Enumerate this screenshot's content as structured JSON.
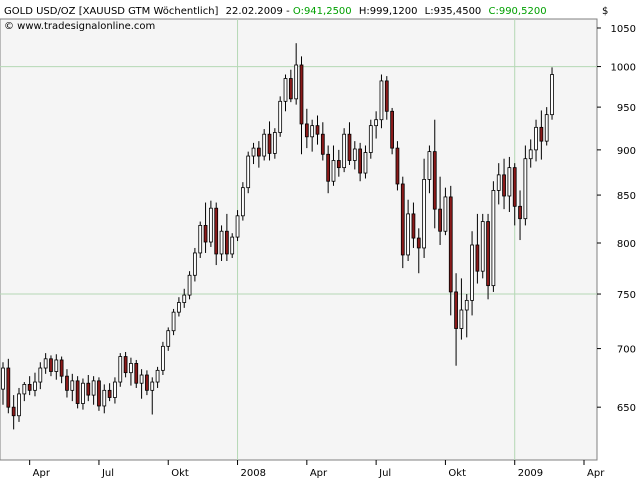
{
  "header": {
    "symbol": "GOLD USD/OZ [XAUUSD GTM  Wöchentlich]",
    "date": "22.02.2009",
    "sep": " - ",
    "open": "O:941,2500",
    "high": "H:999,1200",
    "low": "L:935,4500",
    "close": "C:990,5200",
    "source": "© www.tradesignalonline.com"
  },
  "axis_unit": "$",
  "colors": {
    "background": "#f5f5f5",
    "grid": "#b5d8b5",
    "up_candle": "#ffffff",
    "down_candle": "#8b1a1a",
    "outline": "#000000",
    "positive_text": "#00a000"
  },
  "chart_data": {
    "type": "candlestick",
    "series": [
      {
        "name": "GOLD USD/OZ",
        "interval": "weekly"
      }
    ],
    "ylim": [
      608,
      1062
    ],
    "y_scale": "log",
    "yticks": [
      650,
      700,
      750,
      800,
      850,
      900,
      950,
      1000,
      1050
    ],
    "y_tick_labels": [
      "650",
      "700",
      "750",
      "800",
      "850",
      "900",
      "950",
      "1000",
      "1050"
    ],
    "xticks": [
      {
        "label": "Apr",
        "week": 5
      },
      {
        "label": "Jul",
        "week": 18
      },
      {
        "label": "Okt",
        "week": 31
      },
      {
        "label": "2008",
        "week": 44
      },
      {
        "label": "Apr",
        "week": 57
      },
      {
        "label": "Jul",
        "week": 70
      },
      {
        "label": "Okt",
        "week": 83
      },
      {
        "label": "2009",
        "week": 96
      },
      {
        "label": "Apr",
        "week": 109
      }
    ],
    "gridlines_y": [
      750,
      1000
    ],
    "gridlines_x_week": [
      44,
      96
    ],
    "weeks_visible": 112,
    "candles": [
      [
        665,
        688,
        652,
        683
      ],
      [
        683,
        691,
        645,
        650
      ],
      [
        650,
        660,
        632,
        643
      ],
      [
        643,
        666,
        638,
        661
      ],
      [
        661,
        671,
        655,
        669
      ],
      [
        669,
        676,
        660,
        664
      ],
      [
        664,
        679,
        659,
        671
      ],
      [
        671,
        688,
        665,
        683
      ],
      [
        683,
        696,
        678,
        691
      ],
      [
        691,
        694,
        676,
        680
      ],
      [
        680,
        695,
        673,
        690
      ],
      [
        690,
        693,
        670,
        676
      ],
      [
        676,
        682,
        658,
        664
      ],
      [
        664,
        678,
        655,
        672
      ],
      [
        672,
        676,
        649,
        653
      ],
      [
        653,
        674,
        648,
        670
      ],
      [
        670,
        677,
        655,
        660
      ],
      [
        660,
        676,
        652,
        672
      ],
      [
        672,
        675,
        647,
        651
      ],
      [
        651,
        669,
        645,
        664
      ],
      [
        664,
        670,
        655,
        658
      ],
      [
        658,
        675,
        653,
        671
      ],
      [
        671,
        696,
        667,
        693
      ],
      [
        693,
        697,
        675,
        679
      ],
      [
        679,
        692,
        668,
        687
      ],
      [
        687,
        690,
        666,
        670
      ],
      [
        670,
        682,
        657,
        677
      ],
      [
        677,
        681,
        660,
        664
      ],
      [
        664,
        675,
        644,
        671
      ],
      [
        671,
        684,
        666,
        681
      ],
      [
        681,
        706,
        677,
        702
      ],
      [
        702,
        719,
        698,
        716
      ],
      [
        716,
        736,
        712,
        733
      ],
      [
        733,
        747,
        729,
        742
      ],
      [
        742,
        755,
        737,
        749
      ],
      [
        749,
        772,
        745,
        768
      ],
      [
        768,
        795,
        762,
        790
      ],
      [
        790,
        822,
        785,
        818
      ],
      [
        818,
        842,
        790,
        801
      ],
      [
        801,
        844,
        796,
        836
      ],
      [
        836,
        842,
        778,
        789
      ],
      [
        789,
        818,
        782,
        812
      ],
      [
        812,
        830,
        782,
        789
      ],
      [
        789,
        810,
        785,
        806
      ],
      [
        806,
        834,
        802,
        828
      ],
      [
        828,
        864,
        823,
        858
      ],
      [
        858,
        898,
        852,
        893
      ],
      [
        893,
        908,
        884,
        902
      ],
      [
        902,
        910,
        880,
        893
      ],
      [
        893,
        924,
        888,
        918
      ],
      [
        918,
        933,
        888,
        896
      ],
      [
        896,
        925,
        890,
        920
      ],
      [
        920,
        963,
        915,
        957
      ],
      [
        957,
        990,
        945,
        985
      ],
      [
        985,
        996,
        956,
        960
      ],
      [
        960,
        1030,
        953,
        1002
      ],
      [
        1002,
        1013,
        895,
        930
      ],
      [
        930,
        948,
        902,
        915
      ],
      [
        915,
        935,
        898,
        928
      ],
      [
        928,
        940,
        906,
        918
      ],
      [
        918,
        932,
        888,
        895
      ],
      [
        895,
        905,
        852,
        865
      ],
      [
        865,
        905,
        860,
        888
      ],
      [
        888,
        900,
        870,
        880
      ],
      [
        880,
        925,
        875,
        918
      ],
      [
        918,
        932,
        883,
        888
      ],
      [
        888,
        910,
        878,
        901
      ],
      [
        901,
        908,
        865,
        874
      ],
      [
        874,
        905,
        868,
        897
      ],
      [
        897,
        935,
        890,
        928
      ],
      [
        928,
        945,
        913,
        935
      ],
      [
        935,
        990,
        925,
        982
      ],
      [
        982,
        988,
        935,
        945
      ],
      [
        945,
        949,
        895,
        902
      ],
      [
        902,
        910,
        855,
        862
      ],
      [
        862,
        870,
        775,
        788
      ],
      [
        788,
        845,
        782,
        830
      ],
      [
        830,
        842,
        795,
        805
      ],
      [
        805,
        815,
        770,
        795
      ],
      [
        795,
        890,
        785,
        867
      ],
      [
        867,
        905,
        852,
        898
      ],
      [
        898,
        935,
        815,
        835
      ],
      [
        835,
        870,
        798,
        812
      ],
      [
        812,
        858,
        808,
        848
      ],
      [
        848,
        860,
        730,
        752
      ],
      [
        752,
        770,
        685,
        718
      ],
      [
        718,
        765,
        708,
        735
      ],
      [
        735,
        750,
        710,
        744
      ],
      [
        744,
        812,
        730,
        798
      ],
      [
        798,
        830,
        760,
        772
      ],
      [
        772,
        830,
        765,
        822
      ],
      [
        822,
        830,
        745,
        758
      ],
      [
        758,
        865,
        752,
        855
      ],
      [
        855,
        885,
        840,
        872
      ],
      [
        872,
        890,
        835,
        849
      ],
      [
        849,
        892,
        832,
        880
      ],
      [
        880,
        885,
        818,
        838
      ],
      [
        838,
        855,
        803,
        825
      ],
      [
        825,
        905,
        818,
        890
      ],
      [
        890,
        912,
        880,
        900
      ],
      [
        900,
        935,
        887,
        926
      ],
      [
        926,
        946,
        889,
        910
      ],
      [
        910,
        950,
        905,
        941
      ],
      [
        941,
        999,
        935,
        990
      ]
    ]
  }
}
